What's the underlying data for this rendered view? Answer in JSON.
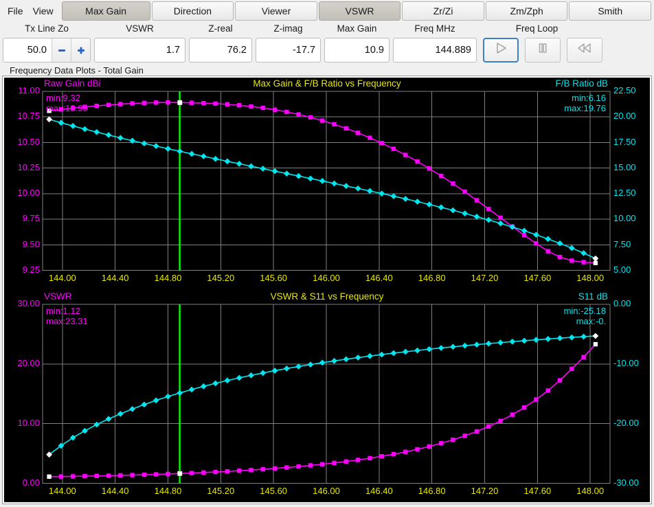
{
  "menu": {
    "items": [
      "File",
      "View"
    ]
  },
  "tabs": [
    {
      "label": "Max Gain",
      "active": true
    },
    {
      "label": "Direction",
      "active": false
    },
    {
      "label": "Viewer",
      "active": false
    },
    {
      "label": "VSWR",
      "active": true
    },
    {
      "label": "Zr/Zi",
      "active": false
    },
    {
      "label": "Zm/Zph",
      "active": false
    },
    {
      "label": "Smith",
      "active": false
    }
  ],
  "fields": [
    {
      "name": "tx-line-zo",
      "label": "Tx Line Zo",
      "value": "50.0",
      "spinner": true
    },
    {
      "name": "vswr",
      "label": "VSWR",
      "value": "1.7",
      "spinner": false
    },
    {
      "name": "z-real",
      "label": "Z-real",
      "value": "76.2",
      "spinner": false
    },
    {
      "name": "z-imag",
      "label": "Z-imag",
      "value": "-17.7",
      "spinner": false
    },
    {
      "name": "max-gain",
      "label": "Max Gain",
      "value": "10.9",
      "spinner": false
    },
    {
      "name": "freq-mhz",
      "label": "Freq MHz",
      "value": "144.889",
      "spinner": false
    }
  ],
  "freq_loop": {
    "label": "Freq Loop",
    "buttons": [
      {
        "name": "play-button",
        "icon": "play-icon",
        "focused": true
      },
      {
        "name": "pause-button",
        "icon": "pause-icon",
        "focused": false
      },
      {
        "name": "rewind-button",
        "icon": "rewind-icon",
        "focused": false
      }
    ]
  },
  "plots_caption": "Frequency Data Plots - Total Gain",
  "colors": {
    "magenta": "#ff00ff",
    "cyan": "#00e5ee",
    "yellow": "#e8e800",
    "grid": "#808080",
    "background": "#000000",
    "cursor": "#00ff00",
    "endpoint": "#ffffff"
  },
  "chart_data": [
    {
      "id": "top",
      "type": "line",
      "title": "Max Gain & F/B Ratio vs Frequency",
      "xlabel": "",
      "grid": true,
      "xlim": [
        143.85,
        148.15
      ],
      "xticks": [
        "144.00",
        "144.40",
        "144.80",
        "145.20",
        "145.60",
        "146.00",
        "146.40",
        "146.80",
        "147.20",
        "147.60",
        "148.00"
      ],
      "xtick_values": [
        144.0,
        144.4,
        144.8,
        145.2,
        145.6,
        146.0,
        146.4,
        146.8,
        147.2,
        147.6,
        148.0
      ],
      "cursor_x": 144.889,
      "axes": [
        {
          "side": "left",
          "label": "Raw Gain dBi",
          "color": "#ff00ff",
          "ylim": [
            9.25,
            11.0
          ],
          "yticks": [
            "11.00",
            "10.75",
            "10.50",
            "10.25",
            "10.00",
            "9.75",
            "9.50",
            "9.25"
          ],
          "ytick_values": [
            11.0,
            10.75,
            10.5,
            10.25,
            10.0,
            9.75,
            9.5,
            9.25
          ],
          "min_label": "min:9.32",
          "max_label": "max:10.90"
        },
        {
          "side": "right",
          "label": "F/B Ratio dB",
          "color": "#00e5ee",
          "ylim": [
            5.0,
            22.5
          ],
          "yticks": [
            "22.50",
            "20.00",
            "17.50",
            "15.00",
            "12.50",
            "10.00",
            "7.50",
            "5.00"
          ],
          "ytick_values": [
            22.5,
            20.0,
            17.5,
            15.0,
            12.5,
            10.0,
            7.5,
            5.0
          ],
          "min_label": "min:6.16",
          "max_label": "max:19.76"
        }
      ],
      "series": [
        {
          "name": "Raw Gain dBi",
          "color": "#ff00ff",
          "axis": "left",
          "marker": "square",
          "x": [
            143.9,
            143.99,
            144.08,
            144.17,
            144.26,
            144.35,
            144.44,
            144.53,
            144.62,
            144.71,
            144.8,
            144.89,
            144.98,
            145.07,
            145.16,
            145.25,
            145.34,
            145.43,
            145.52,
            145.61,
            145.7,
            145.79,
            145.88,
            145.97,
            146.06,
            146.15,
            146.24,
            146.33,
            146.42,
            146.51,
            146.6,
            146.69,
            146.78,
            146.87,
            146.96,
            147.05,
            147.14,
            147.23,
            147.32,
            147.41,
            147.5,
            147.59,
            147.68,
            147.77,
            147.86,
            147.95,
            148.04
          ],
          "y": [
            10.81,
            10.823,
            10.836,
            10.848,
            10.858,
            10.867,
            10.875,
            10.882,
            10.887,
            10.89,
            10.891,
            10.89,
            10.888,
            10.885,
            10.88,
            10.873,
            10.864,
            10.852,
            10.838,
            10.82,
            10.799,
            10.774,
            10.746,
            10.714,
            10.678,
            10.638,
            10.594,
            10.546,
            10.494,
            10.438,
            10.378,
            10.314,
            10.246,
            10.174,
            10.098,
            10.018,
            9.935,
            9.85,
            9.764,
            9.678,
            9.594,
            9.513,
            9.437,
            9.38,
            9.345,
            9.33,
            9.322
          ]
        },
        {
          "name": "F/B Ratio dB",
          "color": "#00e5ee",
          "axis": "right",
          "marker": "diamond",
          "x": [
            143.9,
            143.99,
            144.08,
            144.17,
            144.26,
            144.35,
            144.44,
            144.53,
            144.62,
            144.71,
            144.8,
            144.89,
            144.98,
            145.07,
            145.16,
            145.25,
            145.34,
            145.43,
            145.52,
            145.61,
            145.7,
            145.79,
            145.88,
            145.97,
            146.06,
            146.15,
            146.24,
            146.33,
            146.42,
            146.51,
            146.6,
            146.69,
            146.78,
            146.87,
            146.96,
            147.05,
            147.14,
            147.23,
            147.32,
            147.41,
            147.5,
            147.59,
            147.68,
            147.77,
            147.86,
            147.95,
            148.04
          ],
          "y": [
            19.76,
            19.43,
            19.12,
            18.81,
            18.52,
            18.23,
            17.95,
            17.68,
            17.41,
            17.15,
            16.89,
            16.64,
            16.39,
            16.15,
            15.9,
            15.66,
            15.42,
            15.18,
            14.94,
            14.7,
            14.46,
            14.22,
            13.98,
            13.74,
            13.5,
            13.25,
            13.01,
            12.76,
            12.51,
            12.25,
            11.99,
            11.72,
            11.44,
            11.16,
            10.87,
            10.57,
            10.25,
            9.93,
            9.59,
            9.24,
            8.87,
            8.48,
            8.07,
            7.64,
            7.18,
            6.69,
            6.16
          ]
        }
      ]
    },
    {
      "id": "bottom",
      "type": "line",
      "title": "VSWR & S11 vs Frequency",
      "xlabel": "",
      "grid": true,
      "xlim": [
        143.85,
        148.15
      ],
      "xticks": [
        "144.00",
        "144.40",
        "144.80",
        "145.20",
        "145.60",
        "146.00",
        "146.40",
        "146.80",
        "147.20",
        "147.60",
        "148.00"
      ],
      "xtick_values": [
        144.0,
        144.4,
        144.8,
        145.2,
        145.6,
        146.0,
        146.4,
        146.8,
        147.2,
        147.6,
        148.0
      ],
      "cursor_x": 144.889,
      "axes": [
        {
          "side": "left",
          "label": "VSWR",
          "color": "#ff00ff",
          "ylim": [
            0.0,
            30.0
          ],
          "yticks": [
            "30.00",
            "20.00",
            "10.00",
            "0.00"
          ],
          "ytick_values": [
            30.0,
            20.0,
            10.0,
            0.0
          ],
          "min_label": "min:1.12",
          "max_label": "max:23.31"
        },
        {
          "side": "right",
          "label": "S11 dB",
          "color": "#00e5ee",
          "ylim": [
            -30.0,
            0.0
          ],
          "yticks": [
            "0.00",
            "-10.00",
            "-20.00",
            "-30.00"
          ],
          "ytick_values": [
            0.0,
            -10.0,
            -20.0,
            -30.0
          ],
          "min_label": "min:-25.18",
          "max_label": "max:-0."
        }
      ],
      "series": [
        {
          "name": "VSWR",
          "color": "#ff00ff",
          "axis": "left",
          "marker": "square",
          "x": [
            143.9,
            143.99,
            144.08,
            144.17,
            144.26,
            144.35,
            144.44,
            144.53,
            144.62,
            144.71,
            144.8,
            144.89,
            144.98,
            145.07,
            145.16,
            145.25,
            145.34,
            145.43,
            145.52,
            145.61,
            145.7,
            145.79,
            145.88,
            145.97,
            146.06,
            146.15,
            146.24,
            146.33,
            146.42,
            146.51,
            146.6,
            146.69,
            146.78,
            146.87,
            146.96,
            147.05,
            147.14,
            147.23,
            147.32,
            147.41,
            147.5,
            147.59,
            147.68,
            147.77,
            147.86,
            147.95,
            148.04
          ],
          "y": [
            1.12,
            1.14,
            1.17,
            1.2,
            1.24,
            1.28,
            1.33,
            1.38,
            1.44,
            1.5,
            1.57,
            1.64,
            1.72,
            1.81,
            1.9,
            2.0,
            2.11,
            2.23,
            2.36,
            2.5,
            2.65,
            2.82,
            3.0,
            3.2,
            3.42,
            3.66,
            3.92,
            4.21,
            4.53,
            4.88,
            5.27,
            5.7,
            6.18,
            6.71,
            7.3,
            7.96,
            8.7,
            9.53,
            10.46,
            11.51,
            12.7,
            14.04,
            15.55,
            17.26,
            19.19,
            21.15,
            23.31
          ]
        },
        {
          "name": "S11 dB",
          "color": "#00e5ee",
          "axis": "right",
          "marker": "diamond",
          "x": [
            143.9,
            143.99,
            144.08,
            144.17,
            144.26,
            144.35,
            144.44,
            144.53,
            144.62,
            144.71,
            144.8,
            144.89,
            144.98,
            145.07,
            145.16,
            145.25,
            145.34,
            145.43,
            145.52,
            145.61,
            145.7,
            145.79,
            145.88,
            145.97,
            146.06,
            146.15,
            146.24,
            146.33,
            146.42,
            146.51,
            146.6,
            146.69,
            146.78,
            146.87,
            146.96,
            147.05,
            147.14,
            147.23,
            147.32,
            147.41,
            147.5,
            147.59,
            147.68,
            147.77,
            147.86,
            147.95,
            148.04
          ],
          "y": [
            -25.18,
            -23.7,
            -22.35,
            -21.2,
            -20.15,
            -19.2,
            -18.35,
            -17.55,
            -16.8,
            -16.1,
            -15.45,
            -14.85,
            -14.28,
            -13.74,
            -13.24,
            -12.77,
            -12.32,
            -11.9,
            -11.5,
            -11.12,
            -10.76,
            -10.42,
            -10.09,
            -9.78,
            -9.48,
            -9.2,
            -8.93,
            -8.67,
            -8.42,
            -8.18,
            -7.95,
            -7.73,
            -7.52,
            -7.31,
            -7.12,
            -6.93,
            -6.75,
            -6.58,
            -6.41,
            -6.25,
            -6.1,
            -5.95,
            -5.81,
            -5.67,
            -5.54,
            -5.42,
            -5.3
          ]
        }
      ]
    }
  ]
}
